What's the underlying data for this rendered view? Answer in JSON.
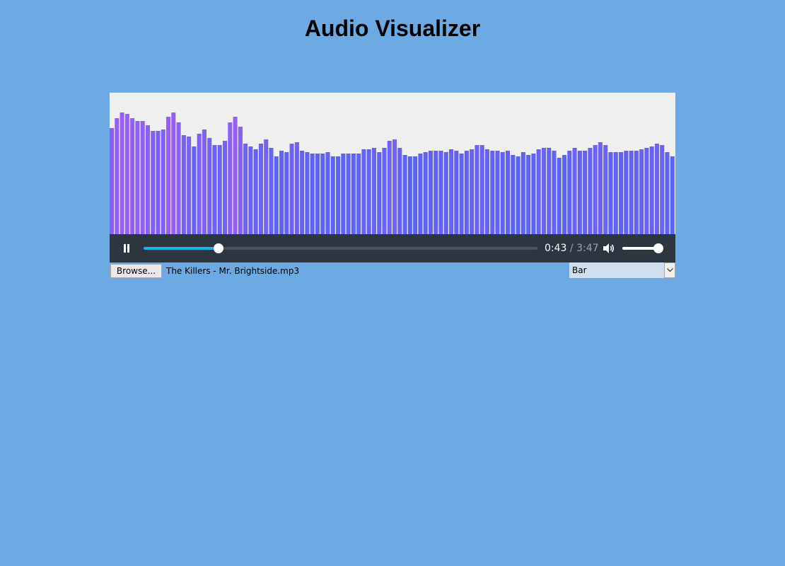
{
  "page": {
    "title": "Audio Visualizer",
    "background": "#6daae4"
  },
  "visualizer": {
    "background": "#efefef",
    "gradient_low": "#5b63f5",
    "gradient_high": "#9a5ef5",
    "bars": [
      0.75,
      0.82,
      0.86,
      0.85,
      0.82,
      0.8,
      0.8,
      0.77,
      0.73,
      0.73,
      0.74,
      0.83,
      0.86,
      0.79,
      0.7,
      0.69,
      0.62,
      0.71,
      0.74,
      0.68,
      0.63,
      0.63,
      0.66,
      0.79,
      0.83,
      0.76,
      0.64,
      0.62,
      0.6,
      0.64,
      0.67,
      0.61,
      0.55,
      0.59,
      0.58,
      0.64,
      0.65,
      0.59,
      0.58,
      0.57,
      0.57,
      0.57,
      0.58,
      0.55,
      0.55,
      0.57,
      0.57,
      0.57,
      0.57,
      0.6,
      0.6,
      0.61,
      0.58,
      0.61,
      0.66,
      0.67,
      0.61,
      0.56,
      0.55,
      0.55,
      0.57,
      0.58,
      0.59,
      0.59,
      0.59,
      0.58,
      0.6,
      0.59,
      0.57,
      0.59,
      0.6,
      0.63,
      0.63,
      0.6,
      0.59,
      0.59,
      0.58,
      0.59,
      0.56,
      0.55,
      0.58,
      0.56,
      0.57,
      0.6,
      0.61,
      0.61,
      0.59,
      0.54,
      0.56,
      0.59,
      0.61,
      0.59,
      0.59,
      0.61,
      0.63,
      0.65,
      0.63,
      0.58,
      0.58,
      0.58,
      0.59,
      0.59,
      0.59,
      0.6,
      0.61,
      0.62,
      0.64,
      0.63,
      0.58,
      0.55
    ]
  },
  "player": {
    "play_state": "pause",
    "pause_icon": "pause-icon",
    "current_time": "0:43",
    "separator": " / ",
    "total_time": "3:47",
    "progress": 0.19,
    "volume_icon": "speaker-icon",
    "volume": 0.95,
    "accent": "#16b5e8",
    "bar_color": "#2b3640"
  },
  "file_input": {
    "button_label": "Browse...",
    "file_name": "The Killers - Mr. Brightside.mp3"
  },
  "mode_select": {
    "selected": "Bar",
    "arrow_icon": "chevron-down-icon"
  }
}
